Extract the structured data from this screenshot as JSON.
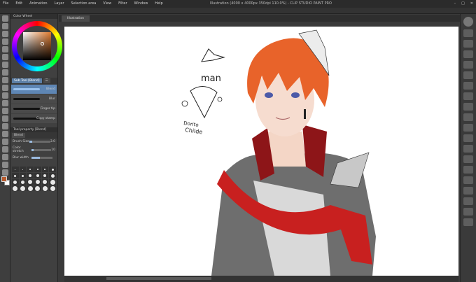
{
  "menu": [
    "File",
    "Edit",
    "Animation",
    "Layer",
    "Selection area",
    "View",
    "Filter",
    "Window",
    "Help"
  ],
  "window_title": "Illustration (4000 x 4000px 350dpi 110.0%) - CLIP STUDIO PAINT PRO",
  "window_controls": [
    "–",
    "□",
    "✕"
  ],
  "color_wheel_title": "Color Wheel",
  "subtool_tabs": [
    "Sub Tool [Blend]",
    "☰"
  ],
  "brushes": [
    {
      "name": "Blend",
      "selected": true
    },
    {
      "name": "Blur",
      "selected": false
    },
    {
      "name": "Finger tip",
      "selected": false
    },
    {
      "name": "Copy stamp",
      "selected": false
    }
  ],
  "tool_property_title": "Tool property [Blend]",
  "tool_property_tab": "Blend",
  "properties": [
    {
      "label": "Brush Size",
      "value": "3.0",
      "fraction": 0.15
    },
    {
      "label": "Color stretch",
      "value": "10",
      "fraction": 0.1
    },
    {
      "label": "Blur width",
      "value": "",
      "fraction": 0.4
    }
  ],
  "document_tab": "Illustration",
  "canvas_text": {
    "top_word": "man",
    "caption_line1": "Dorito",
    "caption_line2": "Childe"
  },
  "colors": {
    "main_color": "#b85b2e",
    "sub_color": "#ffffff",
    "hair": "#e8632a",
    "scarf": "#c8201f",
    "jacket": "#6e6e6e"
  }
}
